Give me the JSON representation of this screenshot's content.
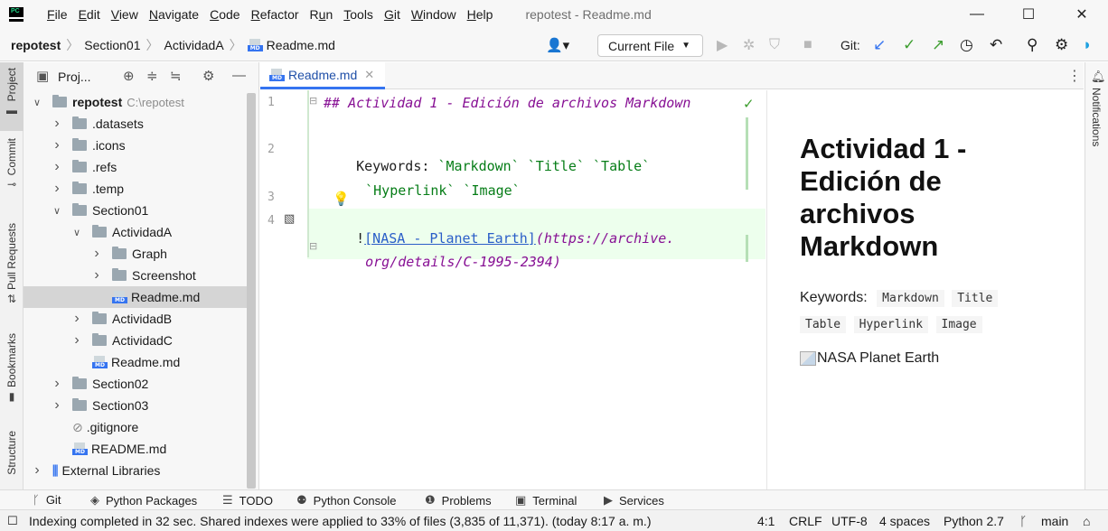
{
  "menu": {
    "items": [
      "File",
      "Edit",
      "View",
      "Navigate",
      "Code",
      "Refactor",
      "Run",
      "Tools",
      "Git",
      "Window",
      "Help"
    ],
    "mnemonics": [
      "F",
      "E",
      "V",
      "N",
      "C",
      "R",
      "u",
      "T",
      "G",
      "W",
      "H"
    ],
    "window_title": "repotest - Readme.md",
    "logo_text": "PC"
  },
  "window_controls": {
    "minimize": "—",
    "maximize": "☐",
    "close": "✕"
  },
  "breadcrumbs": [
    "repotest",
    "Section01",
    "ActividadA",
    "Readme.md"
  ],
  "toolbar": {
    "run_config": "Current File",
    "git_label": "Git:"
  },
  "project": {
    "header_label": "Proj...",
    "tree": [
      {
        "label": "repotest",
        "path": "C:\\repotest",
        "kind": "folder",
        "state": "open",
        "bold": true
      },
      {
        "label": ".datasets",
        "kind": "folder",
        "state": "closed"
      },
      {
        "label": ".icons",
        "kind": "folder",
        "state": "closed"
      },
      {
        "label": ".refs",
        "kind": "folder",
        "state": "closed"
      },
      {
        "label": ".temp",
        "kind": "folder",
        "state": "closed"
      },
      {
        "label": "Section01",
        "kind": "folder",
        "state": "open"
      },
      {
        "label": "ActividadA",
        "kind": "folder",
        "state": "open"
      },
      {
        "label": "Graph",
        "kind": "folder",
        "state": "closed"
      },
      {
        "label": "Screenshot",
        "kind": "folder",
        "state": "closed"
      },
      {
        "label": "Readme.md",
        "kind": "md",
        "state": "none",
        "selected": true
      },
      {
        "label": "ActividadB",
        "kind": "folder",
        "state": "closed"
      },
      {
        "label": "ActividadC",
        "kind": "folder",
        "state": "closed"
      },
      {
        "label": "Readme.md",
        "kind": "md",
        "state": "none"
      },
      {
        "label": "Section02",
        "kind": "folder",
        "state": "closed"
      },
      {
        "label": "Section03",
        "kind": "folder",
        "state": "closed"
      },
      {
        "label": ".gitignore",
        "kind": "ignore",
        "state": "none"
      },
      {
        "label": "README.md",
        "kind": "md",
        "state": "none"
      },
      {
        "label": "External Libraries",
        "kind": "libs",
        "state": "closed"
      }
    ]
  },
  "left_tabs": [
    "Project",
    "Commit",
    "Pull Requests",
    "Bookmarks",
    "Structure"
  ],
  "right_tabs": [
    "Notifications"
  ],
  "editor": {
    "tab_label": "Readme.md",
    "line_numbers": [
      "1",
      "2",
      "3",
      "4"
    ],
    "line1": "## Actividad 1 - Edición de archivos Markdown",
    "line2_prefix": "Keywords: ",
    "line2_codes": [
      "`Markdown`",
      "`Title`",
      "`Table`"
    ],
    "line2b_codes": [
      "`Hyperlink`",
      "`Image`"
    ],
    "line4_bang": "!",
    "line4_link": "[NASA - Planet Earth]",
    "line4_url1": "(https://archive.",
    "line4_url2": "org/details/C-1995-2394)"
  },
  "preview": {
    "title": "Actividad 1 - Edición de archivos Markdown",
    "keywords_label": "Keywords:",
    "keywords": [
      "Markdown",
      "Title",
      "Table",
      "Hyperlink",
      "Image"
    ],
    "image_alt": "NASA Planet Earth"
  },
  "bottom_tools": [
    "Git",
    "Python Packages",
    "TODO",
    "Python Console",
    "Problems",
    "Terminal",
    "Services"
  ],
  "status": {
    "message": "Indexing completed in 32 sec. Shared indexes were applied to 33% of files (3,835 of 11,371). (today 8:17 a. m.)",
    "position": "4:1",
    "line_sep": "CRLF",
    "encoding": "UTF-8",
    "indent": "4 spaces",
    "interpreter": "Python 2.7",
    "branch": "main"
  }
}
